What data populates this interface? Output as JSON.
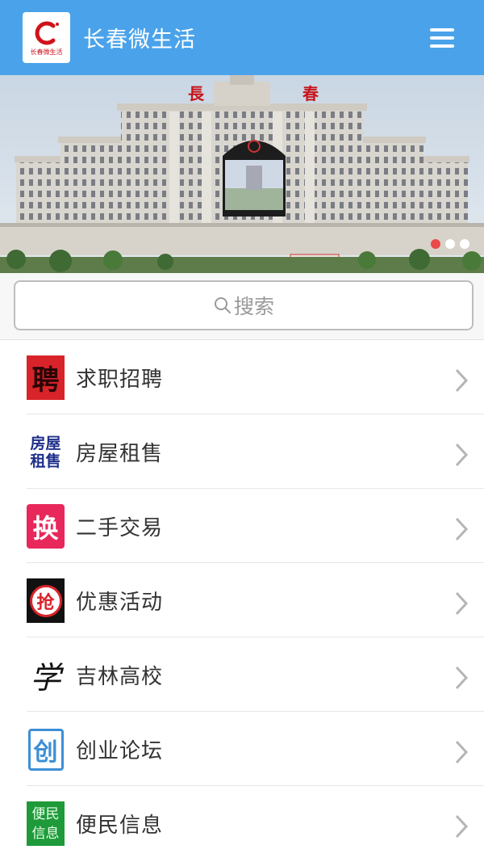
{
  "header": {
    "logo_text": "长春微生活",
    "title": "长春微生活",
    "menu_icon": "hamburger-menu-icon",
    "bg_color": "#4aa3ea"
  },
  "banner": {
    "image": "changchun-railway-station-photo",
    "sign_left": "長",
    "sign_right": "春",
    "slides": 3,
    "active_slide": 1,
    "active_dot_color": "#ea4a4a"
  },
  "search": {
    "placeholder": "搜索",
    "icon": "search-icon"
  },
  "menu": {
    "items": [
      {
        "label": "求职招聘",
        "icon": "recruit-icon",
        "icon_text": "聘"
      },
      {
        "label": "房屋租售",
        "icon": "housing-icon",
        "icon_text": "房屋租售"
      },
      {
        "label": "二手交易",
        "icon": "exchange-icon",
        "icon_text": "换"
      },
      {
        "label": "优惠活动",
        "icon": "promotion-icon",
        "icon_text": "抢"
      },
      {
        "label": "吉林高校",
        "icon": "school-icon",
        "icon_text": "学"
      },
      {
        "label": "创业论坛",
        "icon": "startup-icon",
        "icon_text": "创"
      },
      {
        "label": "便民信息",
        "icon": "info-icon",
        "icon_text": "便民信息"
      }
    ]
  }
}
